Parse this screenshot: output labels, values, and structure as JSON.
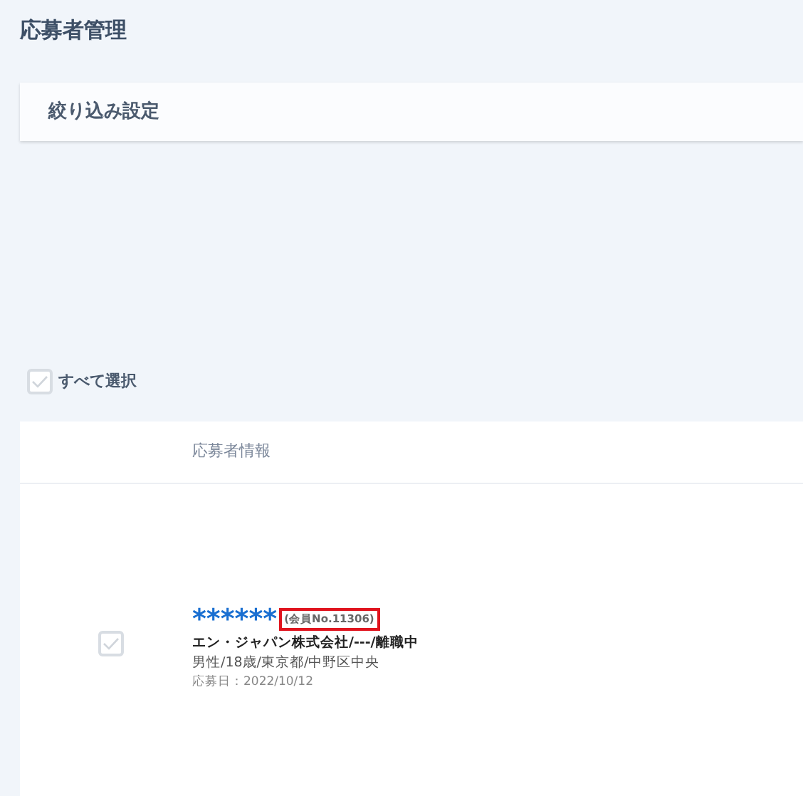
{
  "page_title": "応募者管理",
  "filter_panel": {
    "title": "絞り込み設定"
  },
  "select_all": {
    "label": "すべて選択",
    "checked": false
  },
  "table": {
    "columns": [
      "応募者情報"
    ],
    "rows": [
      {
        "checked": false,
        "name": "******",
        "member_no": "(会員No.11306)",
        "member_no_highlighted": true,
        "company": "エン・ジャパン株式会社/---/離職中",
        "profile": "男性/18歳/東京都/中野区中央",
        "applied": "応募日：2022/10/12"
      }
    ]
  }
}
